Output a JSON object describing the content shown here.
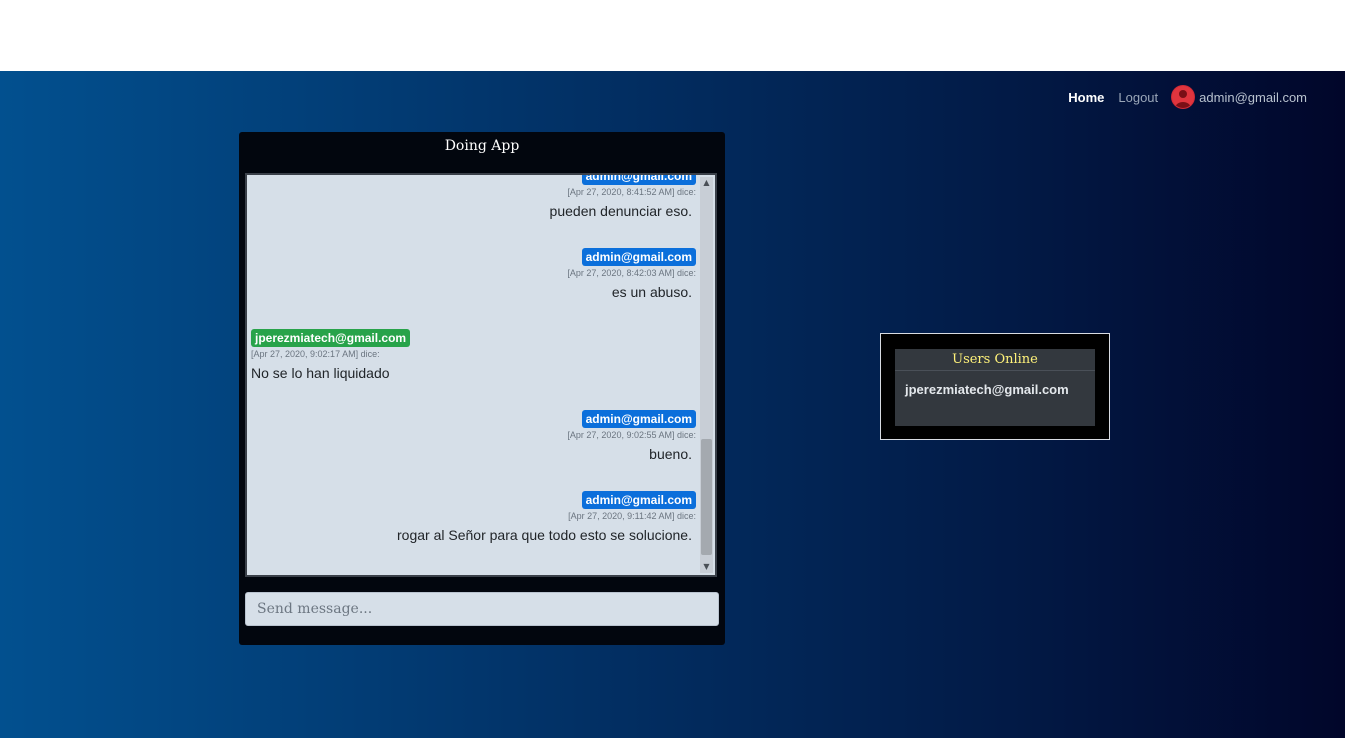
{
  "nav": {
    "home_label": "Home",
    "logout_label": "Logout",
    "user_email": "admin@gmail.com"
  },
  "chat": {
    "title": "Doing App",
    "input_placeholder": "Send message...",
    "messages": [
      {
        "user": "admin@gmail.com",
        "meta": "[Apr 27, 2020, 8:41:52 AM] dice:",
        "text": "pueden denunciar eso.",
        "side": "right"
      },
      {
        "user": "admin@gmail.com",
        "meta": "[Apr 27, 2020, 8:42:03 AM] dice:",
        "text": "es un abuso.",
        "side": "right"
      },
      {
        "user": "jperezmiatech@gmail.com",
        "meta": "[Apr 27, 2020, 9:02:17 AM] dice:",
        "text": "No se lo han liquidado",
        "side": "left"
      },
      {
        "user": "admin@gmail.com",
        "meta": "[Apr 27, 2020, 9:02:55 AM] dice:",
        "text": "bueno.",
        "side": "right"
      },
      {
        "user": "admin@gmail.com",
        "meta": "[Apr 27, 2020, 9:11:42 AM] dice:",
        "text": "rogar al Señor para que todo esto se solucione.",
        "side": "right"
      }
    ]
  },
  "users_online": {
    "title": "Users Online",
    "users": [
      "jperezmiatech@gmail.com"
    ]
  },
  "colors": {
    "admin_badge": "#0b6fdb",
    "other_badge": "#28a34a",
    "users_title": "#fff27a"
  }
}
